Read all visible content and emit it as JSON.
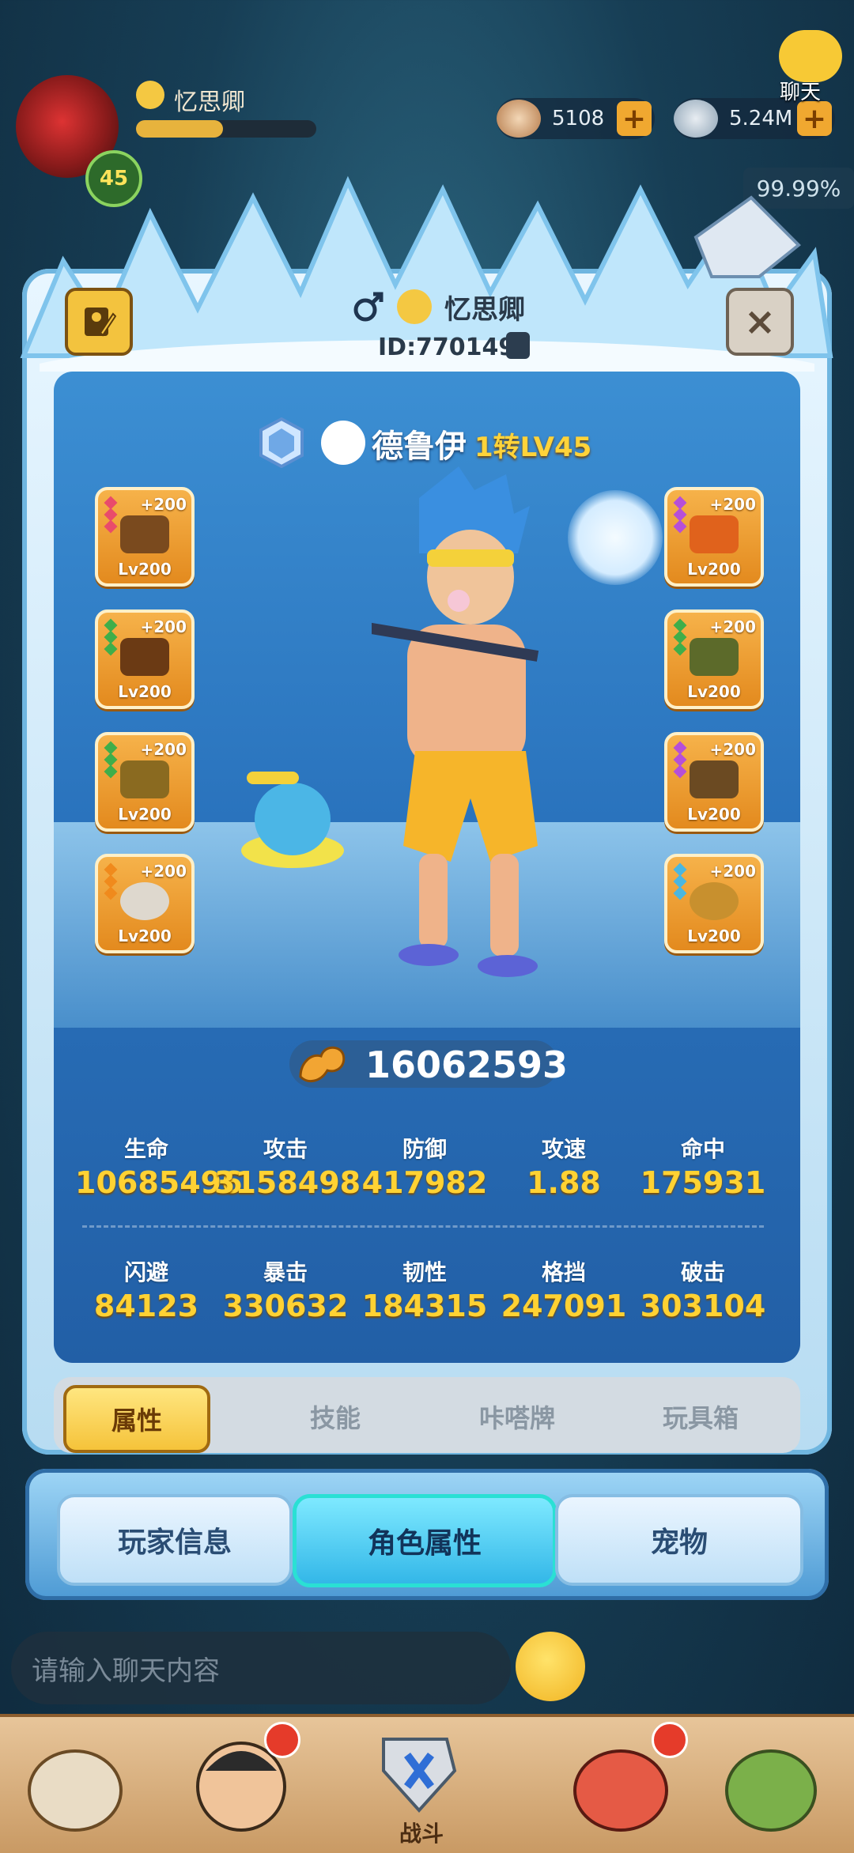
{
  "hud": {
    "player_name": "忆思卿",
    "level": "45",
    "coins": "5108",
    "shells": "5.24M",
    "percent": "99.99%",
    "chat_label": "聊天"
  },
  "profile": {
    "name": "忆思卿",
    "id": "ID:770149",
    "class_name": "德鲁伊",
    "class_level": "1转LV45"
  },
  "equipment": {
    "left": [
      {
        "plus": "+200",
        "level": "Lv200",
        "gem_color": "#e94b6b"
      },
      {
        "plus": "+200",
        "level": "Lv200",
        "gem_color": "#3fae4a"
      },
      {
        "plus": "+200",
        "level": "Lv200",
        "gem_color": "#3fae4a"
      },
      {
        "plus": "+200",
        "level": "Lv200",
        "gem_color": "#f08a1c"
      }
    ],
    "right": [
      {
        "plus": "+200",
        "level": "Lv200",
        "gem_color": "#b64fd8"
      },
      {
        "plus": "+200",
        "level": "Lv200",
        "gem_color": "#3fae4a"
      },
      {
        "plus": "+200",
        "level": "Lv200",
        "gem_color": "#b64fd8"
      },
      {
        "plus": "+200",
        "level": "Lv200",
        "gem_color": "#4ab7e0"
      }
    ]
  },
  "power": "16062593",
  "stats": [
    {
      "label": "生命",
      "value": "10685496"
    },
    {
      "label": "攻击",
      "value": "3158498"
    },
    {
      "label": "防御",
      "value": "417982"
    },
    {
      "label": "攻速",
      "value": "1.88"
    },
    {
      "label": "命中",
      "value": "175931"
    },
    {
      "label": "闪避",
      "value": "84123"
    },
    {
      "label": "暴击",
      "value": "330632"
    },
    {
      "label": "韧性",
      "value": "184315"
    },
    {
      "label": "格挡",
      "value": "247091"
    },
    {
      "label": "破击",
      "value": "303104"
    }
  ],
  "sub_tabs": [
    "属性",
    "技能",
    "咔嗒牌",
    "玩具箱"
  ],
  "main_tabs": [
    "玩家信息",
    "角色属性",
    "宠物"
  ],
  "chat": {
    "placeholder": "请输入聊天内容"
  },
  "nav": {
    "battle_label": "战斗"
  },
  "colors": {
    "accent": "#f5c33a",
    "stat_value": "#ffd233",
    "active_tab": "#33b7e8"
  }
}
